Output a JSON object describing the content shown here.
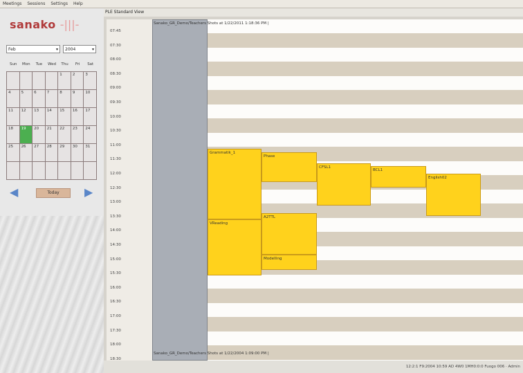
{
  "menu": [
    "Meetings",
    "Sessions",
    "Settings",
    "Help"
  ],
  "logo": {
    "text": "sanako",
    "mark": "-|||-"
  },
  "calendar": {
    "month": "Feb",
    "year": "2004",
    "dow": [
      "Sun",
      "Mon",
      "Tue",
      "Wed",
      "Thu",
      "Fri",
      "Sat"
    ],
    "cells": [
      "",
      "",
      "",
      "",
      "1",
      "2",
      "3",
      "4",
      "5",
      "6",
      "7",
      "8",
      "9",
      "10",
      "11",
      "12",
      "13",
      "14",
      "15",
      "16",
      "17",
      "18",
      "19",
      "20",
      "21",
      "22",
      "23",
      "24",
      "25",
      "26",
      "27",
      "28",
      "29",
      "30",
      "31",
      "",
      "",
      "",
      "",
      "",
      "",
      ""
    ],
    "today_label": "Today"
  },
  "view_title": "PLE Standard View",
  "times": [
    "07:45",
    "07:30",
    "08:00",
    "08:30",
    "09:00",
    "09:30",
    "10:00",
    "10:30",
    "11:00",
    "11:30",
    "12:00",
    "12:30",
    "13:00",
    "13:30",
    "14:00",
    "14:30",
    "15:00",
    "15:30",
    "16:00",
    "16:30",
    "17:00",
    "17:30",
    "18:00",
    "18:30"
  ],
  "teacher_header": "Sanako_GR_Demo/Teachers Shots at 1/22/2011 1:18:36 PM |",
  "teacher_footer": "Sanako_GR_Demo/Teachers Shots at 1/22/2004 1:09:00 PM |",
  "bookings": [
    {
      "label": "Grammatik_1"
    },
    {
      "label": "Phase"
    },
    {
      "label": "CFSL1"
    },
    {
      "label": "BCL1"
    },
    {
      "label": "English02"
    },
    {
      "label": "VReading"
    },
    {
      "label": "A2TTL"
    },
    {
      "label": "Modelling"
    }
  ],
  "status": "12:2:1 F9:2004 10:59 AD 4W0 1MH0:0:0 Fuogo 006 · Admin"
}
